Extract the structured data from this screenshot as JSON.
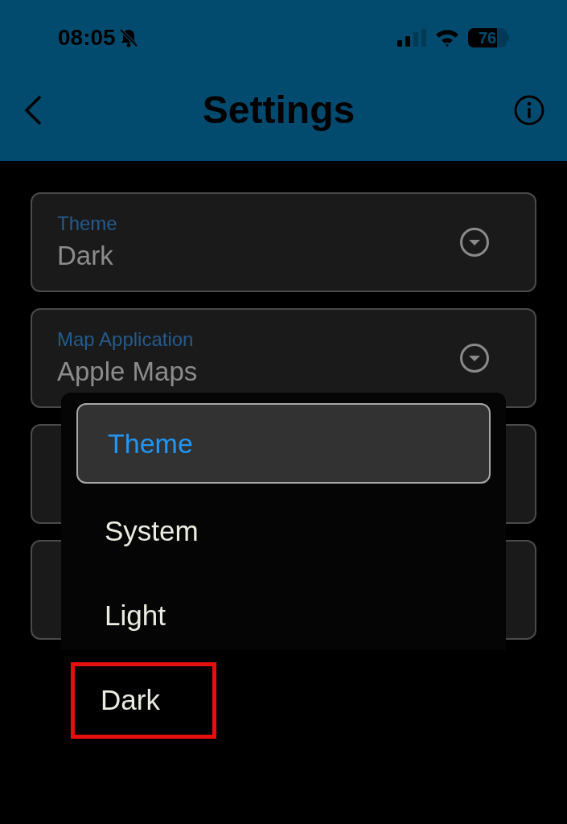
{
  "status_bar": {
    "time": "08:05",
    "silent": true,
    "battery": "76"
  },
  "header": {
    "title": "Settings"
  },
  "fields": [
    {
      "kind": "select",
      "label": "Theme",
      "value": "Dark"
    },
    {
      "kind": "select",
      "label": "Map Application",
      "value": "Apple Maps"
    },
    {
      "kind": "covered"
    },
    {
      "kind": "covered"
    }
  ],
  "menu": {
    "title": "Theme",
    "items": [
      {
        "label": "System",
        "highlighted": false
      },
      {
        "label": "Light",
        "highlighted": false
      },
      {
        "label": "Dark",
        "highlighted": true
      }
    ]
  }
}
